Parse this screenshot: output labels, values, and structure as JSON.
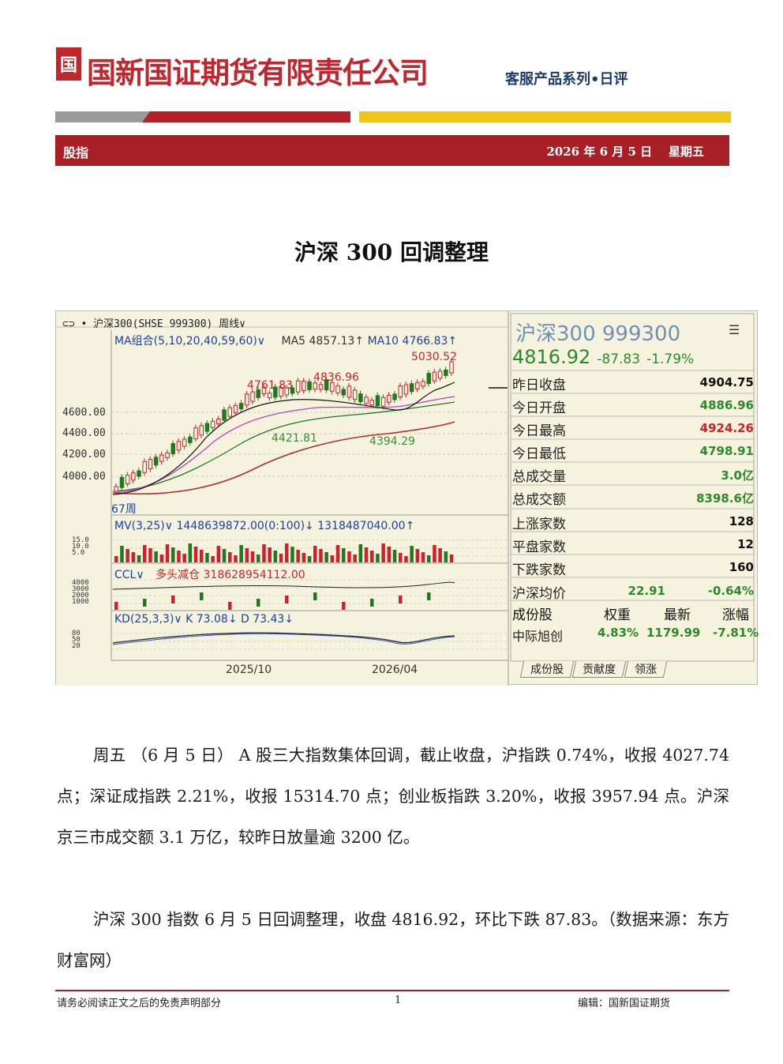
{
  "header": {
    "logo_glyph": "国",
    "company": "国新国证期货有限责任公司",
    "series": "客服产品系列•日评",
    "section": "股指",
    "date": "2026 年 6 月 5 日    星期五"
  },
  "title": "沪深 300  回调整理",
  "chart": {
    "toolbar": "⊂⊃ • 沪深300(SHSE 999300)  周线∨",
    "ma_label": "MA组合(5,10,20,40,59,60)∨",
    "ma5": "MA5 4857.13↑",
    "ma10": "MA10 4766.83↑",
    "yticks": [
      "4600.00",
      "4400.00",
      "4200.00",
      "4000.00"
    ],
    "annotations": {
      "high1": "4761.83",
      "high2": "4836.96",
      "high3": "5030.52",
      "low1": "4421.81",
      "low2": "4394.29",
      "weeks": "67周"
    },
    "mv_label": "MV(3,25)∨  1448639872.00(0:100)↓  1318487040.00↑",
    "mv_ticks": [
      "15.0",
      "10.0",
      "5.0"
    ],
    "ccl_label": "CCL∨",
    "ccl_value": "多头减仓 318628954112.00",
    "ccl_ticks": [
      "4000",
      "3000",
      "2000",
      "1000"
    ],
    "kd_label": "KD(25,3,3)∨  K 73.08↓ D 73.43↓",
    "kd_ticks": [
      "80",
      "50",
      "20"
    ],
    "xticks": [
      "2025/10",
      "2026/04"
    ],
    "colors": {
      "up": "#d0202a",
      "down": "#1f7a1f",
      "ma5": "#111111",
      "ma10": "#c040c0",
      "ma20": "#1f7a1f",
      "ma40": "#b03030"
    }
  },
  "chart_data": {
    "type": "candlestick",
    "title": "沪深300(SHSE 999300) 周线",
    "ylim": [
      3800,
      5100
    ],
    "series": [
      {
        "name": "MA5",
        "values": []
      },
      {
        "name": "MA10",
        "values": []
      }
    ]
  },
  "quote": {
    "name": "沪深300  999300",
    "menu_icon": "list-icon",
    "price": "4816.92",
    "change": "-87.83",
    "pct": "-1.79%",
    "rows": [
      {
        "k": "昨日收盘",
        "v": "4904.75",
        "c": "blk"
      },
      {
        "k": "今日开盘",
        "v": "4886.96",
        "c": "green"
      },
      {
        "k": "今日最高",
        "v": "4924.26",
        "c": "red"
      },
      {
        "k": "今日最低",
        "v": "4798.91",
        "c": "green"
      },
      {
        "k": "总成交量",
        "v": "3.0亿",
        "c": "green"
      },
      {
        "k": "总成交额",
        "v": "8398.6亿",
        "c": "green"
      },
      {
        "k": "上涨家数",
        "v": "128",
        "c": "blk"
      },
      {
        "k": "平盘家数",
        "v": "12",
        "c": "blk"
      },
      {
        "k": "下跌家数",
        "v": "160",
        "c": "blk"
      }
    ],
    "avg_label": "沪深均价",
    "avg_price": "22.91",
    "avg_pct": "-0.64%",
    "cons_headers": [
      "成份股",
      "权重",
      "最新",
      "涨幅"
    ],
    "cons_row": [
      "中际旭创",
      "4.83%",
      "1179.99",
      "-7.81%"
    ],
    "tabs": [
      "成份股",
      "贡献度",
      "领涨"
    ]
  },
  "body": {
    "p1": "周五 （6 月 5 日）  A 股三大指数集体回调，截止收盘，沪指跌 0.74%，收报 4027.74 点；深证成指跌 2.21%，收报 15314.70 点；创业板指跌 3.20%，收报 3957.94 点。沪深京三市成交额 3.1 万亿，较昨日放量逾 3200 亿。",
    "p2": "沪深 300 指数 6 月 5 日回调整理，收盘 4816.92，环比下跌 87.83。（数据来源：东方财富网）"
  },
  "footer": {
    "left": "请务必阅读正文之后的免责声明部分",
    "page": "1",
    "right": "编辑：国新国证期货"
  }
}
